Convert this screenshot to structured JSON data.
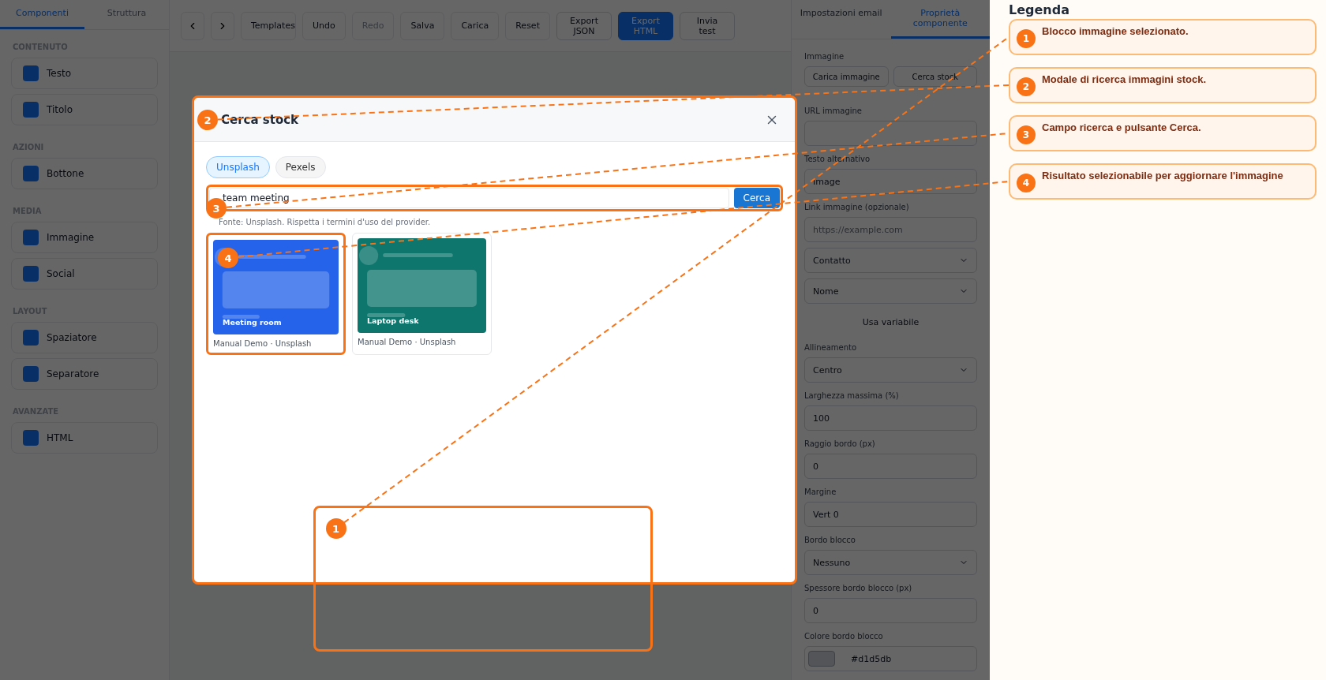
{
  "sidebar": {
    "tabs": [
      {
        "label": "Componenti",
        "selected": true
      },
      {
        "label": "Struttura",
        "selected": false
      }
    ],
    "groups": [
      {
        "title": "CONTENUTO",
        "items": [
          {
            "label": "Testo"
          },
          {
            "label": "Titolo"
          }
        ]
      },
      {
        "title": "AZIONI",
        "items": [
          {
            "label": "Bottone"
          }
        ]
      },
      {
        "title": "MEDIA",
        "items": [
          {
            "label": "Immagine"
          },
          {
            "label": "Social"
          }
        ]
      },
      {
        "title": "LAYOUT",
        "items": [
          {
            "label": "Spaziatore"
          },
          {
            "label": "Separatore"
          }
        ]
      },
      {
        "title": "AVANZATE",
        "items": [
          {
            "label": "HTML"
          }
        ]
      }
    ]
  },
  "toolbar": {
    "buttons": [
      {
        "label": "Templates",
        "kind": "plain",
        "disabled": false
      },
      {
        "label": "Undo",
        "kind": "plain",
        "disabled": false
      },
      {
        "label": "Redo",
        "kind": "plain",
        "disabled": true
      },
      {
        "label": "Salva",
        "kind": "plain",
        "disabled": false
      },
      {
        "label": "Carica",
        "kind": "plain",
        "disabled": false
      },
      {
        "label": "Reset",
        "kind": "plain",
        "disabled": false
      },
      {
        "label": "Export JSON",
        "kind": "outline",
        "disabled": false
      },
      {
        "label": "Export HTML",
        "kind": "primary",
        "disabled": false
      },
      {
        "label": "Invia test",
        "kind": "outline",
        "disabled": false
      }
    ]
  },
  "canvas": {
    "selected_block": {
      "marker": "1"
    }
  },
  "properties": {
    "tabs": [
      {
        "label": "Impostazioni email",
        "selected": false
      },
      {
        "label": "Proprietà componente",
        "selected": true
      }
    ],
    "section": "Immagine",
    "rows": [
      {
        "kind": "buttons",
        "labels": [
          "Carica immagine",
          "Cerca stock"
        ]
      },
      {
        "kind": "label",
        "text": "URL immagine"
      },
      {
        "kind": "input",
        "value": ""
      },
      {
        "kind": "label",
        "text": "Testo alternativo"
      },
      {
        "kind": "input",
        "value": "Image"
      },
      {
        "kind": "label",
        "text": "Link immagine (opzionale)"
      },
      {
        "kind": "input",
        "placeholder": "https://example.com"
      },
      {
        "kind": "select",
        "value": "Contatto"
      },
      {
        "kind": "select",
        "value": "Nome"
      },
      {
        "kind": "button",
        "text": "Usa variabile"
      },
      {
        "kind": "label",
        "text": "Allineamento"
      },
      {
        "kind": "select",
        "value": "Centro"
      },
      {
        "kind": "label",
        "text": "Larghezza massima (%)"
      },
      {
        "kind": "input",
        "value": "100"
      },
      {
        "kind": "label",
        "text": "Raggio bordo (px)"
      },
      {
        "kind": "input",
        "value": "0"
      },
      {
        "kind": "label",
        "text": "Margine"
      },
      {
        "kind": "input",
        "value": "Vert 0"
      },
      {
        "kind": "label",
        "text": "Bordo blocco"
      },
      {
        "kind": "select",
        "value": "Nessuno"
      },
      {
        "kind": "label",
        "text": "Spessore bordo blocco (px)"
      },
      {
        "kind": "input",
        "value": "0"
      },
      {
        "kind": "label",
        "text": "Colore bordo blocco"
      },
      {
        "kind": "color",
        "value": "#d1d5db"
      }
    ]
  },
  "modal": {
    "title": "Cerca stock",
    "marker": "2",
    "providers": [
      {
        "label": "Unsplash",
        "selected": true
      },
      {
        "label": "Pexels",
        "selected": false
      }
    ],
    "search": {
      "value": "team meeting",
      "button": "Cerca",
      "marker": "3"
    },
    "hint": "Fonte: Unsplash. Rispetta i termini d'uso del provider.",
    "results": [
      {
        "title": "Meeting room",
        "credit": "Manual Demo · Unsplash",
        "color": "#2563eb",
        "marker": "4"
      },
      {
        "title": "Laptop desk",
        "credit": "Manual Demo · Unsplash",
        "color": "#0f766e"
      }
    ]
  },
  "legend": {
    "title": "Legenda",
    "items": [
      {
        "number": "1",
        "text": "Blocco immagine selezionato."
      },
      {
        "number": "2",
        "text": "Modale di ricerca immagini stock."
      },
      {
        "number": "3",
        "text": "Campo ricerca e pulsante Cerca."
      },
      {
        "number": "4",
        "text": "Risultato selezionabile per aggiornare l'immagine"
      }
    ]
  }
}
